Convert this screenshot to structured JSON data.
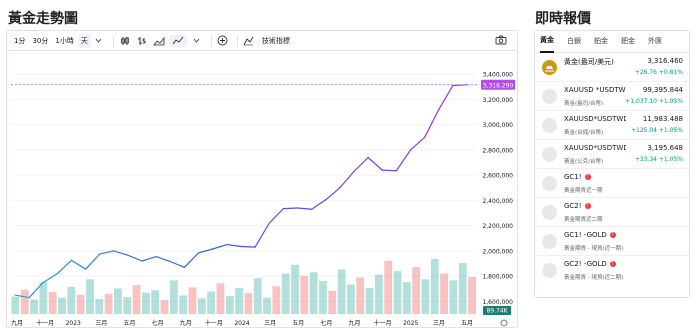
{
  "titles": {
    "chart": "黃金走勢圖",
    "panel": "即時報價"
  },
  "toolbar": {
    "intervals": [
      "1分",
      "30分",
      "1小時",
      "天"
    ],
    "active_interval": "天",
    "indicators_label": "技術指標"
  },
  "chart_data": {
    "type": "line",
    "title": "",
    "ylim": [
      1500000,
      3560000
    ],
    "y_ticks": [
      "3,400,000",
      "3,200,000",
      "3,000,000",
      "2,800,000",
      "2,600,000",
      "2,400,000",
      "2,200,000",
      "2,000,000",
      "1,800,000",
      "1,600,000"
    ],
    "y_tick_values": [
      3400000,
      3200000,
      3000000,
      2800000,
      2600000,
      2400000,
      2200000,
      2000000,
      1800000,
      1600000
    ],
    "x_tick_labels": [
      "九月",
      "十一月",
      "2023",
      "三月",
      "五月",
      "七月",
      "九月",
      "十一月",
      "2024",
      "三月",
      "五月",
      "七月",
      "九月",
      "十一月",
      "2025",
      "三月",
      "五月"
    ],
    "last_price_label": "3,316.290",
    "last_price": 3316290,
    "volume_label": "89.74K",
    "series": [
      {
        "x": [
          "2022-09",
          "2022-10",
          "2022-11",
          "2022-12",
          "2023-01",
          "2023-02",
          "2023-03",
          "2023-04",
          "2023-05",
          "2023-06",
          "2023-07",
          "2023-08",
          "2023-09",
          "2023-10",
          "2023-11",
          "2023-12",
          "2024-01",
          "2024-02",
          "2024-03",
          "2024-04",
          "2024-05",
          "2024-06",
          "2024-07",
          "2024-08",
          "2024-09",
          "2024-10",
          "2024-11",
          "2024-12",
          "2025-01",
          "2025-02",
          "2025-03",
          "2025-04",
          "2025-05"
        ],
        "values": [
          1650000,
          1630000,
          1750000,
          1820000,
          1925000,
          1855000,
          1975000,
          2000000,
          1965000,
          1920000,
          1955000,
          1915000,
          1870000,
          1985000,
          2015000,
          2050000,
          2035000,
          2030000,
          2220000,
          2335000,
          2340000,
          2330000,
          2405000,
          2500000,
          2630000,
          2740000,
          2640000,
          2635000,
          2800000,
          2900000,
          3120000,
          3310000,
          3316000
        ]
      }
    ],
    "volume": [
      30,
      42,
      25,
      55,
      38,
      28,
      47,
      33,
      60,
      26,
      35,
      44,
      29,
      50,
      37,
      41,
      24,
      58,
      32,
      46,
      27,
      39,
      53,
      31,
      45,
      36,
      62,
      28,
      48,
      70,
      85,
      66,
      72,
      57,
      40,
      77,
      51,
      63,
      45,
      68,
      92,
      74,
      55,
      81,
      60,
      95,
      70,
      58,
      88,
      64
    ],
    "colors": {
      "line_start": "#2a9bd8",
      "line_mid": "#3a5ad8",
      "line_end": "#a030e8",
      "price_line": "#b34ce8",
      "up": "#26a69a",
      "down": "#ef5350"
    }
  },
  "panel": {
    "tabs": [
      "黃金",
      "白銀",
      "鉑金",
      "鈀金",
      "外匯"
    ],
    "active_tab": "黃金",
    "rows": [
      {
        "sym": "黃金(盎司/美元)",
        "price": "3,316.460",
        "chg": "+26.76  +0.81%",
        "sub": ""
      },
      {
        "sym": "XAUUSD *USDTWD",
        "price": "99,395.844",
        "chg": "+1,037.10  +1.05%",
        "sub": "黃金(盎司/台幣)"
      },
      {
        "sym": "XAUUSD*USDTWD/",
        "price": "11,983.488",
        "chg": "+125.04  +1.05%",
        "sub": "黃金(台錢/台幣)"
      },
      {
        "sym": "XAUUSD*USDTWD/",
        "price": "3,195.648",
        "chg": "+33.34  +1.05%",
        "sub": "黃金(公克/台幣)"
      },
      {
        "sym": "GC1!",
        "price": "",
        "chg": "",
        "sub": "黃金期貨近一期"
      },
      {
        "sym": "GC2!",
        "price": "",
        "chg": "",
        "sub": "黃金期貨近二期"
      },
      {
        "sym": "GC1! -GOLD",
        "price": "",
        "chg": "",
        "sub": "黃金期貨 - 現貨(近一期)"
      },
      {
        "sym": "GC2! -GOLD",
        "price": "",
        "chg": "",
        "sub": "黃金期貨 - 現貨(近二期)"
      }
    ]
  }
}
